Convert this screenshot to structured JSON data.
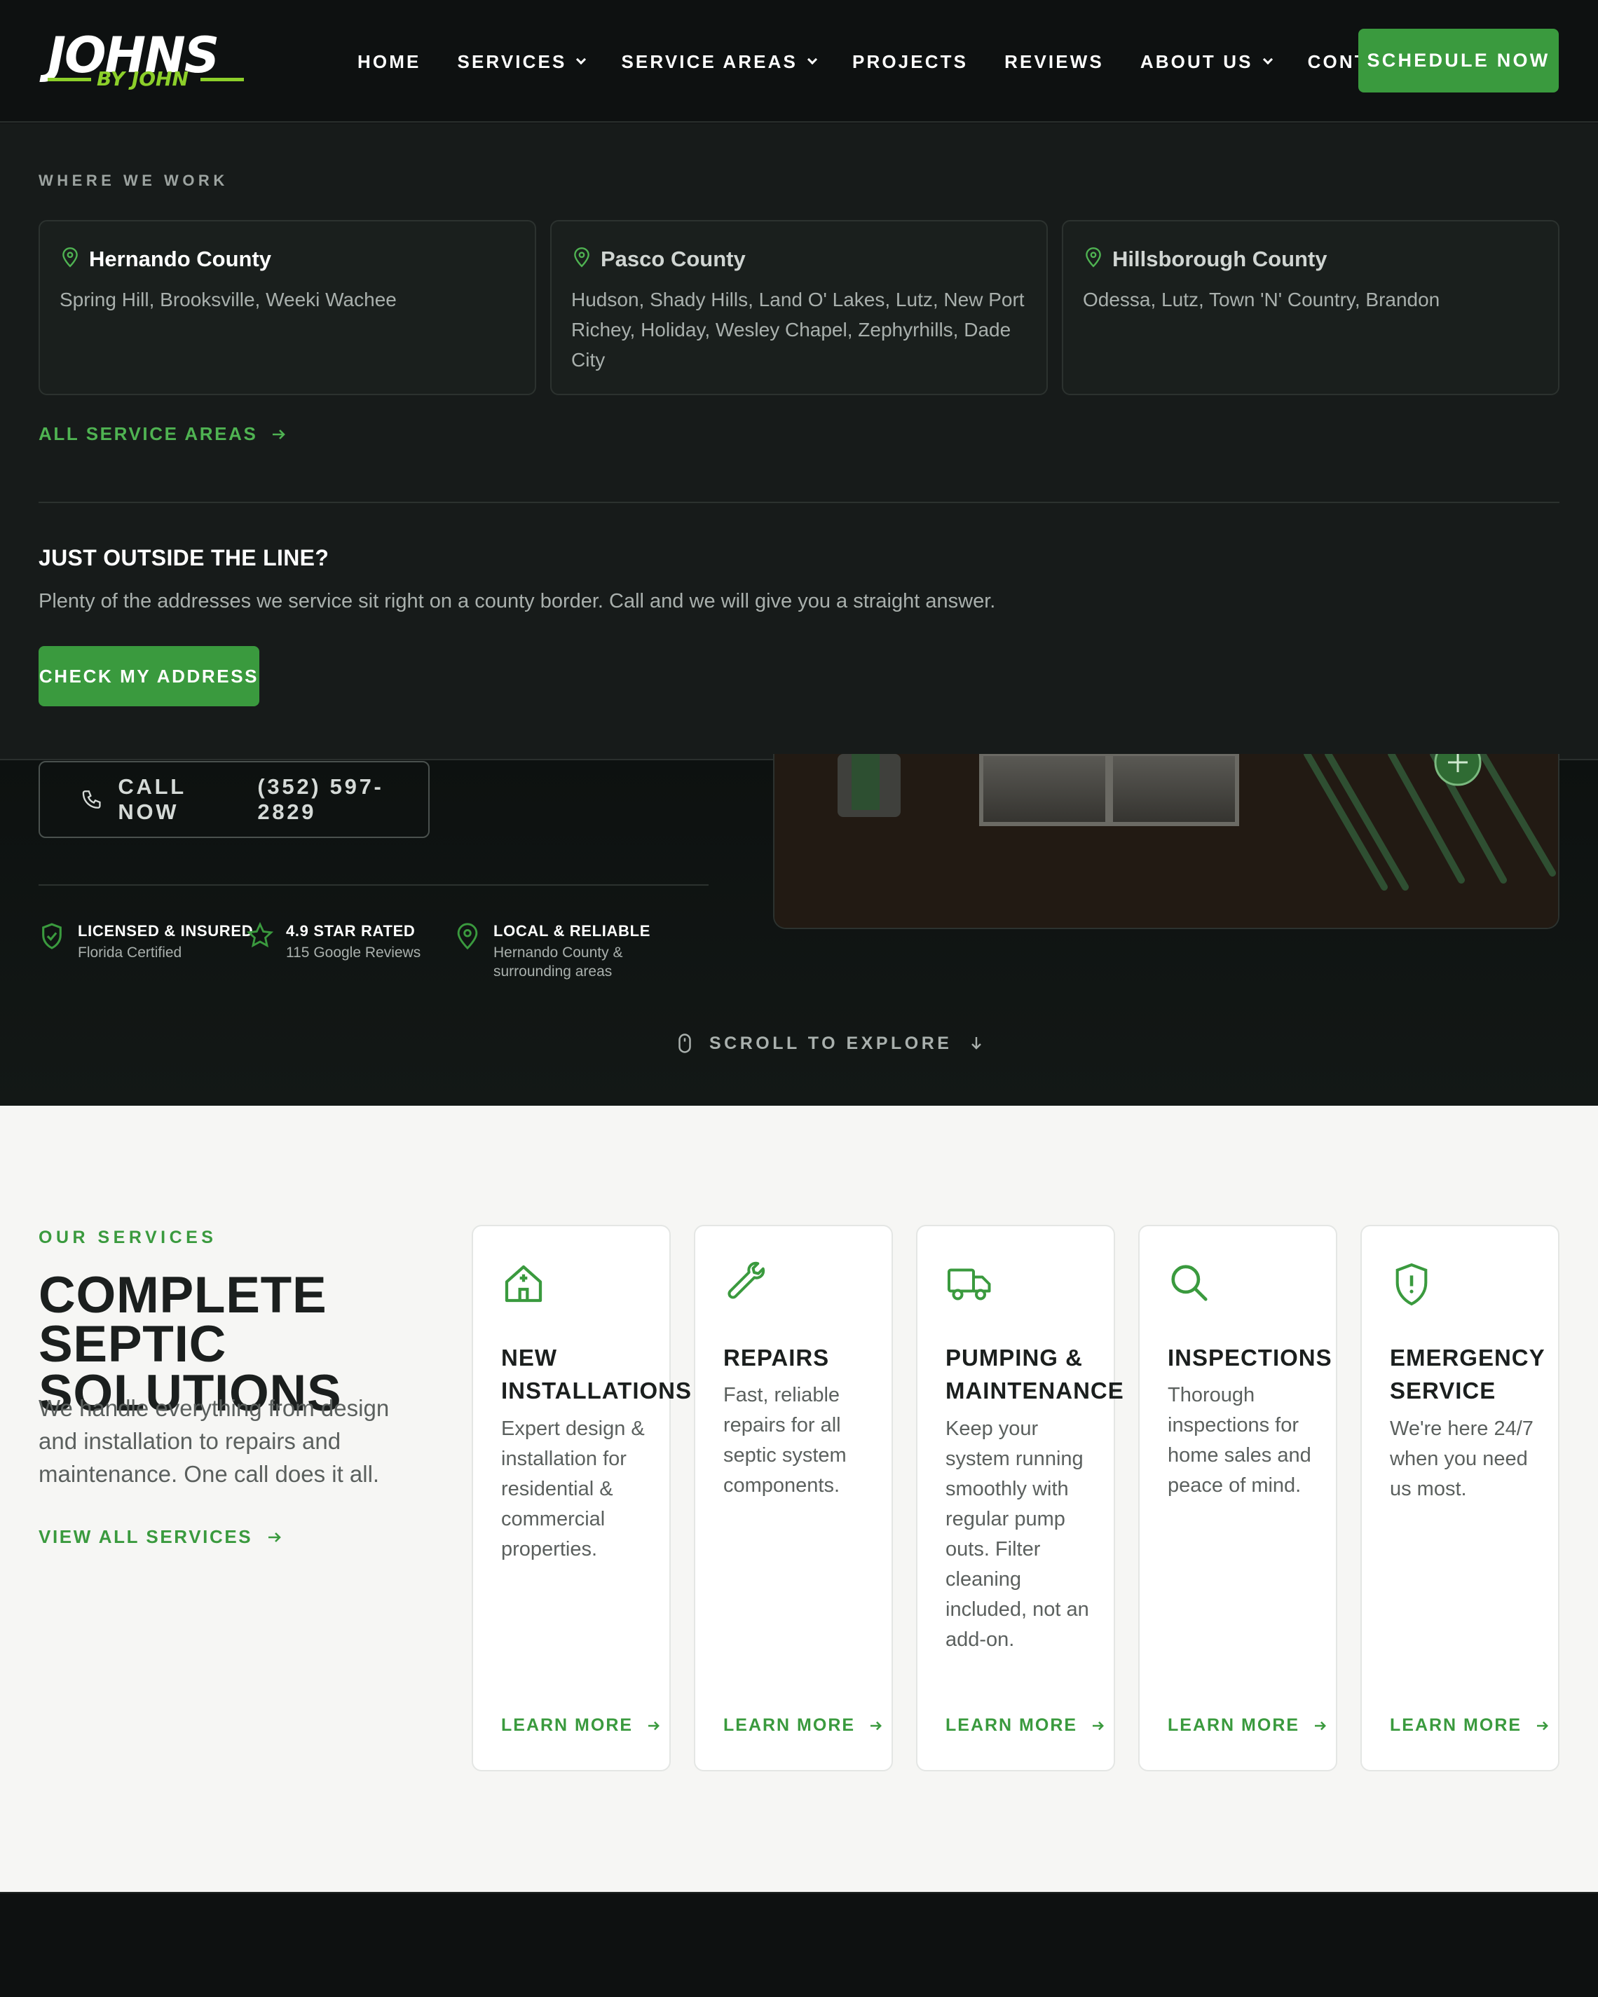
{
  "header": {
    "logo_main": "JOHNS",
    "logo_sub": "BY JOHN",
    "nav": [
      {
        "label": "HOME"
      },
      {
        "label": "SERVICES"
      },
      {
        "label": "SERVICE AREAS"
      },
      {
        "label": "PROJECTS"
      },
      {
        "label": "REVIEWS"
      },
      {
        "label": "ABOUT US"
      },
      {
        "label": "CONTACT"
      }
    ],
    "cta": "SCHEDULE NOW"
  },
  "dropdown": {
    "eyebrow": "WHERE WE WORK",
    "counties": [
      {
        "name": "Hernando County",
        "towns": "Spring Hill, Brooksville, Weeki Wachee"
      },
      {
        "name": "Pasco County",
        "towns": "Hudson, Shady Hills, Land O' Lakes, Lutz, New Port Richey, Holiday, Wesley Chapel, Zephyrhills, Dade City"
      },
      {
        "name": "Hillsborough County",
        "towns": "Odessa, Lutz, Town 'N' Country, Brandon"
      }
    ],
    "all_areas": "ALL SERVICE AREAS",
    "outside_title": "JUST OUTSIDE THE LINE?",
    "outside_text": "Plenty of the addresses we service sit right on a county border. Call and we will give you a straight answer.",
    "check_button": "CHECK MY ADDRESS"
  },
  "hero": {
    "call_label": "CALL NOW",
    "phone": "(352) 597-2829",
    "badges": [
      {
        "title": "LICENSED & INSURED",
        "sub": "Florida Certified",
        "icon": "shield-check-icon"
      },
      {
        "title": "4.9 STAR RATED",
        "sub": "115 Google Reviews",
        "icon": "star-icon"
      },
      {
        "title": "LOCAL & RELIABLE",
        "sub": "Hernando County & surrounding areas",
        "icon": "map-pin-icon"
      }
    ],
    "scroll": "SCROLL TO EXPLORE"
  },
  "services": {
    "eyebrow": "OUR SERVICES",
    "title": "COMPLETE SEPTIC SOLUTIONS",
    "description": "We handle everything from design and installation to repairs and maintenance. One call does it all.",
    "view_all": "VIEW ALL SERVICES",
    "cards": [
      {
        "title": "New Installations",
        "desc": "Expert design & installation for residential & commercial properties.",
        "link": "LEARN MORE",
        "icon": "house-plus-icon"
      },
      {
        "title": "Repairs",
        "desc": "Fast, reliable repairs for all septic system components.",
        "link": "LEARN MORE",
        "icon": "wrench-icon"
      },
      {
        "title": "Pumping & Maintenance",
        "desc": "Keep your system running smoothly with regular pump outs. Filter cleaning included, not an add-on.",
        "link": "LEARN MORE",
        "icon": "truck-icon"
      },
      {
        "title": "Inspections",
        "desc": "Thorough inspections for home sales and peace of mind.",
        "link": "LEARN MORE",
        "icon": "search-icon"
      },
      {
        "title": "Emergency Service",
        "desc": "We're here 24/7 when you need us most.",
        "link": "LEARN MORE",
        "icon": "shield-alert-icon"
      }
    ]
  },
  "colors": {
    "accent": "#3a9a3e",
    "logo_green": "#8ccf2a",
    "dark_bg": "#0e1111",
    "light_bg": "#f6f6f4"
  }
}
